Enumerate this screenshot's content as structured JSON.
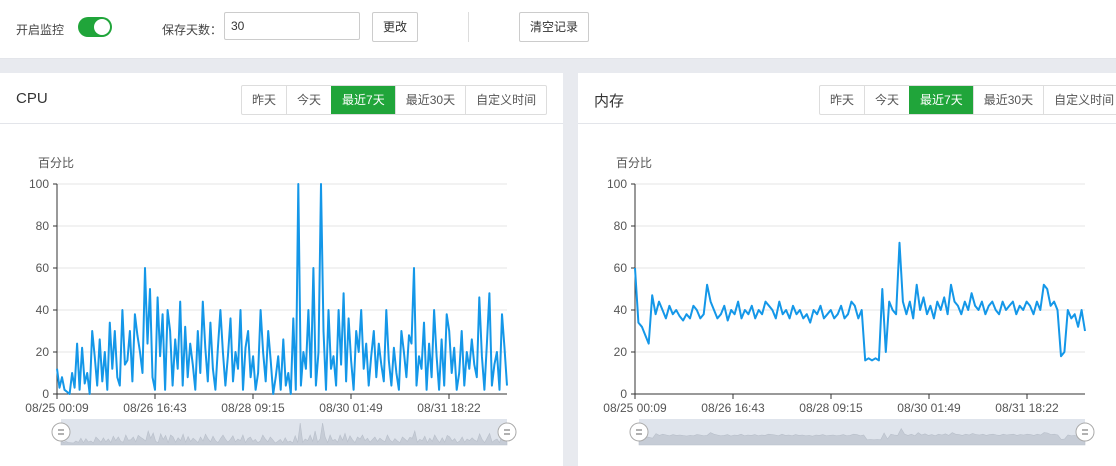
{
  "toolbar": {
    "monitor_label": "开启监控",
    "monitor_enabled": true,
    "keep_days_label": "保存天数：",
    "keep_days_value": "30",
    "change_button": "更改",
    "clear_button": "清空记录"
  },
  "ranges": [
    "昨天",
    "今天",
    "最近7天",
    "最近30天",
    "自定义时间"
  ],
  "active_range": "最近7天",
  "panels": {
    "cpu": {
      "title": "CPU"
    },
    "mem": {
      "title": "内存"
    }
  },
  "colors": {
    "accent": "#20a53a",
    "line": "#1497e8"
  },
  "chart_data": [
    {
      "type": "line",
      "title": "CPU",
      "ylabel": "百分比",
      "ylim": [
        0,
        100
      ],
      "yticks": [
        0,
        20,
        40,
        60,
        80,
        100
      ],
      "x_ticks": [
        "08/25 00:09",
        "08/26 16:43",
        "08/28 09:15",
        "08/30 01:49",
        "08/31 18:22"
      ],
      "grid": true,
      "series": [
        {
          "values": [
            12,
            3,
            8,
            2,
            1,
            0,
            10,
            3,
            24,
            2,
            22,
            5,
            10,
            0,
            30,
            18,
            4,
            26,
            6,
            20,
            2,
            34,
            12,
            30,
            8,
            4,
            40,
            14,
            16,
            30,
            6,
            38,
            28,
            20,
            10,
            60,
            24,
            50,
            8,
            2,
            46,
            18,
            38,
            2,
            40,
            30,
            4,
            26,
            12,
            44,
            4,
            32,
            8,
            24,
            14,
            2,
            30,
            10,
            44,
            22,
            6,
            34,
            12,
            2,
            22,
            40,
            20,
            4,
            18,
            36,
            6,
            20,
            12,
            40,
            2,
            22,
            30,
            8,
            18,
            2,
            10,
            40,
            20,
            6,
            30,
            16,
            0,
            8,
            18,
            2,
            26,
            4,
            10,
            0,
            36,
            2,
            100,
            4,
            20,
            12,
            40,
            8,
            60,
            4,
            20,
            100,
            30,
            2,
            40,
            12,
            18,
            4,
            40,
            14,
            48,
            6,
            36,
            16,
            2,
            30,
            20,
            40,
            12,
            24,
            4,
            18,
            30,
            8,
            24,
            14,
            6,
            40,
            16,
            4,
            22,
            10,
            2,
            30,
            20,
            8,
            28,
            24,
            60,
            4,
            18,
            12,
            34,
            2,
            24,
            8,
            40,
            18,
            2,
            26,
            4,
            38,
            30,
            10,
            22,
            2,
            10,
            30,
            4,
            20,
            12,
            26,
            14,
            8,
            46,
            18,
            2,
            24,
            48,
            4,
            14,
            20,
            2,
            38,
            22,
            4
          ]
        }
      ]
    },
    {
      "type": "line",
      "title": "内存",
      "ylabel": "百分比",
      "ylim": [
        0,
        100
      ],
      "yticks": [
        0,
        20,
        40,
        60,
        80,
        100
      ],
      "x_ticks": [
        "08/25 00:09",
        "08/26 16:43",
        "08/28 09:15",
        "08/30 01:49",
        "08/31 18:22"
      ],
      "grid": true,
      "series": [
        {
          "values": [
            60,
            34,
            32,
            28,
            24,
            47,
            38,
            44,
            40,
            36,
            42,
            38,
            40,
            37,
            35,
            38,
            36,
            42,
            40,
            36,
            38,
            52,
            44,
            40,
            36,
            38,
            42,
            35,
            40,
            38,
            44,
            36,
            40,
            38,
            42,
            36,
            40,
            38,
            44,
            42,
            40,
            36,
            44,
            38,
            40,
            36,
            42,
            38,
            40,
            36,
            38,
            34,
            40,
            38,
            42,
            36,
            38,
            40,
            36,
            38,
            42,
            36,
            38,
            44,
            42,
            36,
            40,
            16,
            17,
            16,
            17,
            16,
            50,
            20,
            44,
            40,
            38,
            72,
            44,
            38,
            44,
            36,
            52,
            40,
            46,
            38,
            42,
            36,
            44,
            40,
            46,
            38,
            52,
            44,
            42,
            38,
            44,
            40,
            48,
            42,
            40,
            44,
            38,
            42,
            44,
            40,
            38,
            44,
            40,
            42,
            44,
            38,
            42,
            40,
            44,
            42,
            38,
            44,
            40,
            52,
            50,
            42,
            44,
            40,
            18,
            20,
            40,
            36,
            38,
            32,
            40,
            30
          ]
        }
      ]
    }
  ]
}
